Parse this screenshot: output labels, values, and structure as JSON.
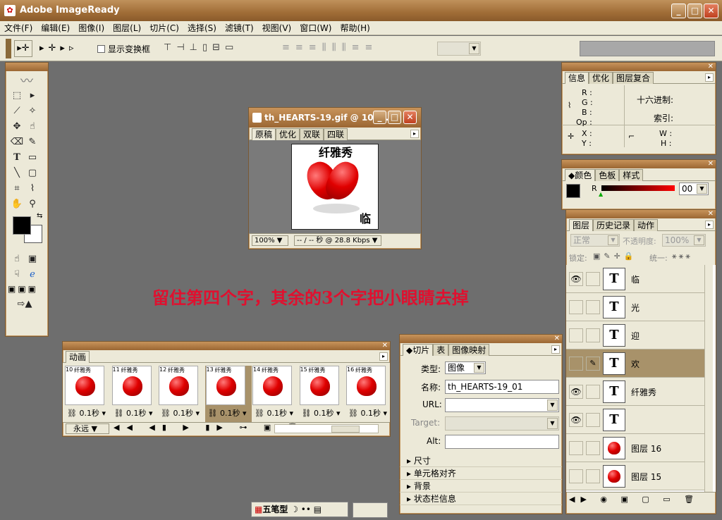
{
  "app": {
    "title": "Adobe ImageReady"
  },
  "menu": [
    "文件(F)",
    "编辑(E)",
    "图像(I)",
    "图层(L)",
    "切片(C)",
    "选择(S)",
    "滤镜(T)",
    "视图(V)",
    "窗口(W)",
    "帮助(H)"
  ],
  "optbar": {
    "show_transform": "显示变换框"
  },
  "doc": {
    "title": "th_HEARTS-19.gif @ 100...",
    "tabs": [
      "原稿",
      "优化",
      "双联",
      "四联"
    ],
    "zoom": "100%",
    "status": "-- / -- 秒 @ 28.8 Kbps",
    "img_text": "纤雅秀",
    "img_char": "临"
  },
  "annotation": "留住第四个字，其余的3个字把小眼睛去掉",
  "info": {
    "tabs": [
      "信息",
      "优化",
      "图层复合"
    ],
    "r": "R :",
    "g": "G :",
    "b": "B :",
    "op": "Op :",
    "hex": "十六进制:",
    "index": "索引:",
    "x": "X :",
    "y": "Y :",
    "w": "W :",
    "h": "H :"
  },
  "color": {
    "tabs": [
      "颜色",
      "色板",
      "样式"
    ],
    "r_label": "R",
    "value": "00"
  },
  "layers": {
    "tabs": [
      "图层",
      "历史记录",
      "动作"
    ],
    "blend": "正常",
    "opacity_label": "不透明度:",
    "opacity": "100%",
    "lock_label": "锁定:",
    "unify_label": "统一:",
    "rows": [
      {
        "name": "临",
        "thumb": "T",
        "eye": true
      },
      {
        "name": "光",
        "thumb": "T",
        "eye": false
      },
      {
        "name": "迎",
        "thumb": "T",
        "eye": false
      },
      {
        "name": "欢",
        "thumb": "T",
        "eye": false
      },
      {
        "name": "纤雅秀",
        "thumb": "T",
        "eye": true
      },
      {
        "name": "",
        "thumb": "T",
        "eye": true
      },
      {
        "name": "图层 16",
        "thumb": "",
        "eye": false
      },
      {
        "name": "图层 15",
        "thumb": "",
        "eye": false
      }
    ]
  },
  "animation": {
    "tab": "动画",
    "frames": [
      {
        "num": "10",
        "delay": "0.1秒"
      },
      {
        "num": "11",
        "delay": "0.1秒"
      },
      {
        "num": "12",
        "delay": "0.1秒"
      },
      {
        "num": "13",
        "delay": "0.1秒"
      },
      {
        "num": "14",
        "delay": "0.1秒"
      },
      {
        "num": "15",
        "delay": "0.1秒"
      },
      {
        "num": "16",
        "delay": "0.1秒"
      }
    ],
    "frame_title": "纤雅秀",
    "loop": "永远"
  },
  "slice": {
    "tabs": [
      "切片",
      "表",
      "图像映射"
    ],
    "type_label": "类型:",
    "type_value": "图像",
    "name_label": "名称:",
    "name_value": "th_HEARTS-19_01",
    "url_label": "URL:",
    "target_label": "Target:",
    "alt_label": "Alt:",
    "sections": [
      "尺寸",
      "单元格对齐",
      "背景",
      "状态栏信息"
    ]
  },
  "ime": {
    "label": "五笔型"
  }
}
